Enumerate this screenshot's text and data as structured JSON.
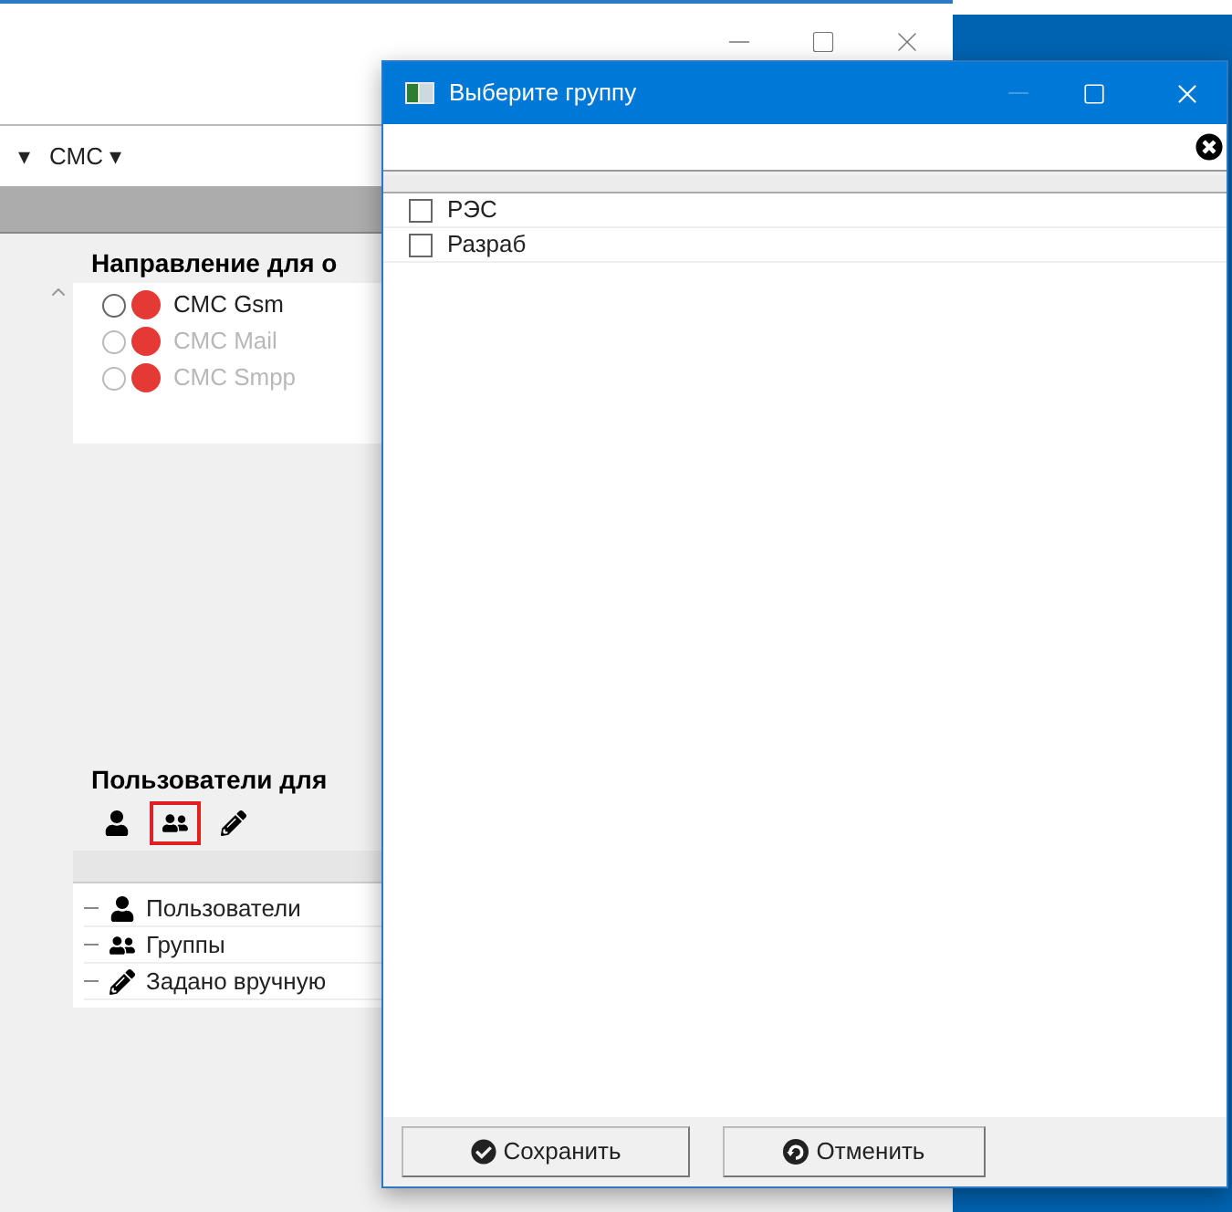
{
  "background_window": {
    "menu": [
      "▾",
      "СМС ▾"
    ],
    "direction_section": {
      "title": "Направление для о",
      "options": [
        {
          "label": "СМС Gsm",
          "selected": false,
          "disabled": false
        },
        {
          "label": "СМС Mail",
          "selected": false,
          "disabled": true
        },
        {
          "label": "СМС Smpp",
          "selected": false,
          "disabled": true
        }
      ]
    },
    "users_section": {
      "title": "Пользователи для",
      "toolbar": [
        {
          "kind": "user",
          "highlighted": false
        },
        {
          "kind": "group",
          "highlighted": true
        },
        {
          "kind": "pencil",
          "highlighted": false
        }
      ],
      "tree": [
        {
          "kind": "user",
          "label": "Пользователи"
        },
        {
          "kind": "group",
          "label": "Группы"
        },
        {
          "kind": "pencil",
          "label": "Задано вручную"
        }
      ]
    }
  },
  "dialog": {
    "title": "Выберите группу",
    "items": [
      {
        "label": "РЭС",
        "checked": false
      },
      {
        "label": "Разраб",
        "checked": false
      }
    ],
    "buttons": [
      {
        "kind": "save",
        "label": "Сохранить"
      },
      {
        "kind": "cancel",
        "label": "Отменить"
      }
    ]
  }
}
